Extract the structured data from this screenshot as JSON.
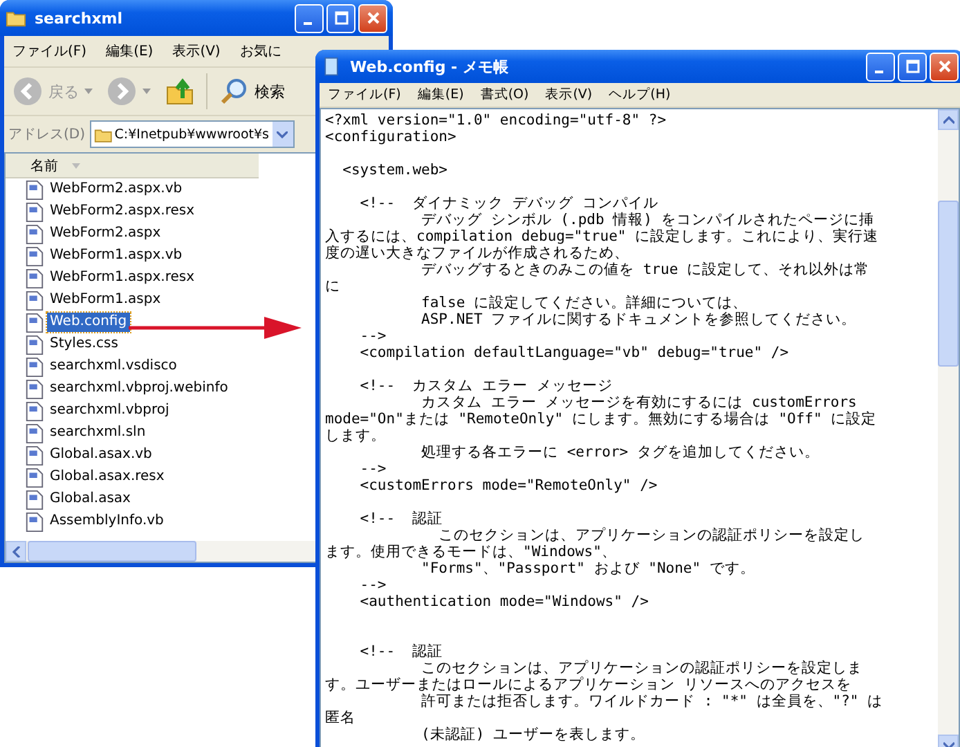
{
  "explorer": {
    "title": "searchxml",
    "menu": [
      "ファイル(F)",
      "編集(E)",
      "表示(V)",
      "お気に"
    ],
    "toolbar": [
      {
        "kind": "back",
        "label": "戻る",
        "disabled": true
      },
      {
        "kind": "forward",
        "disabled": true
      },
      {
        "kind": "up",
        "disabled": false
      },
      {
        "kind": "search",
        "label": "検索",
        "disabled": false
      }
    ],
    "address": {
      "label": "アドレス(D)",
      "value": "C:¥Inetpub¥wwwroot¥s"
    },
    "column": "名前",
    "files": [
      {
        "name": "WebForm2.aspx.vb",
        "selected": false
      },
      {
        "name": "WebForm2.aspx.resx",
        "selected": false
      },
      {
        "name": "WebForm2.aspx",
        "selected": false
      },
      {
        "name": "WebForm1.aspx.vb",
        "selected": false
      },
      {
        "name": "WebForm1.aspx.resx",
        "selected": false
      },
      {
        "name": "WebForm1.aspx",
        "selected": false
      },
      {
        "name": "Web.config",
        "selected": true
      },
      {
        "name": "Styles.css",
        "selected": false
      },
      {
        "name": "searchxml.vsdisco",
        "selected": false
      },
      {
        "name": "searchxml.vbproj.webinfo",
        "selected": false
      },
      {
        "name": "searchxml.vbproj",
        "selected": false
      },
      {
        "name": "searchxml.sln",
        "selected": false
      },
      {
        "name": "Global.asax.vb",
        "selected": false
      },
      {
        "name": "Global.asax.resx",
        "selected": false
      },
      {
        "name": "Global.asax",
        "selected": false
      },
      {
        "name": "AssemblyInfo.vb",
        "selected": false
      }
    ]
  },
  "notepad": {
    "title": "Web.config - メモ帳",
    "menu": [
      "ファイル(F)",
      "編集(E)",
      "書式(O)",
      "表示(V)",
      "ヘルプ(H)"
    ],
    "blocks": [
      {
        "double_gap": false,
        "lines": [
          "<?xml version=\"1.0\" encoding=\"utf-8\" ?>",
          "<configuration>"
        ]
      },
      {
        "double_gap": false,
        "lines": [
          "  <system.web>"
        ]
      },
      {
        "double_gap": false,
        "lines": [
          "    <!--  ダイナミック デバッグ コンパイル",
          "           デバッグ シンボル (.pdb 情報) をコンパイルされたページに挿",
          "入するには、compilation debug=\"true\" に設定します。これにより、実行速",
          "度の遅い大きなファイルが作成されるため、",
          "           デバッグするときのみこの値を true に設定して、それ以外は常",
          "に",
          "           false に設定してください。詳細については、",
          "           ASP.NET ファイルに関するドキュメントを参照してください。",
          "    -->",
          "    <compilation defaultLanguage=\"vb\" debug=\"true\" />"
        ]
      },
      {
        "double_gap": false,
        "lines": [
          "    <!--  カスタム エラー メッセージ",
          "           カスタム エラー メッセージを有効にするには customErrors",
          "mode=\"On\"または \"RemoteOnly\" にします。無効にする場合は \"Off\" に設定",
          "します。",
          "           処理する各エラーに <error> タグを追加してください。",
          "    -->",
          "    <customErrors mode=\"RemoteOnly\" />"
        ]
      },
      {
        "double_gap": false,
        "lines": [
          "    <!--  認証",
          "             このセクションは、アプリケーションの認証ポリシーを設定し",
          "ます。使用できるモードは、\"Windows\"、",
          "           \"Forms\"、\"Passport\" および \"None\" です。",
          "    -->",
          "    <authentication mode=\"Windows\" />"
        ]
      },
      {
        "double_gap": true,
        "lines": [
          "    <!--  認証",
          "           このセクションは、アプリケーションの認証ポリシーを設定しま",
          "す。ユーザーまたはロールによるアプリケーション リソースへのアクセスを",
          "           許可または拒否します。ワイルドカード : \"*\" は全員を、\"?\" は",
          "匿名",
          "           (未認証) ユーザーを表します。"
        ]
      }
    ]
  }
}
